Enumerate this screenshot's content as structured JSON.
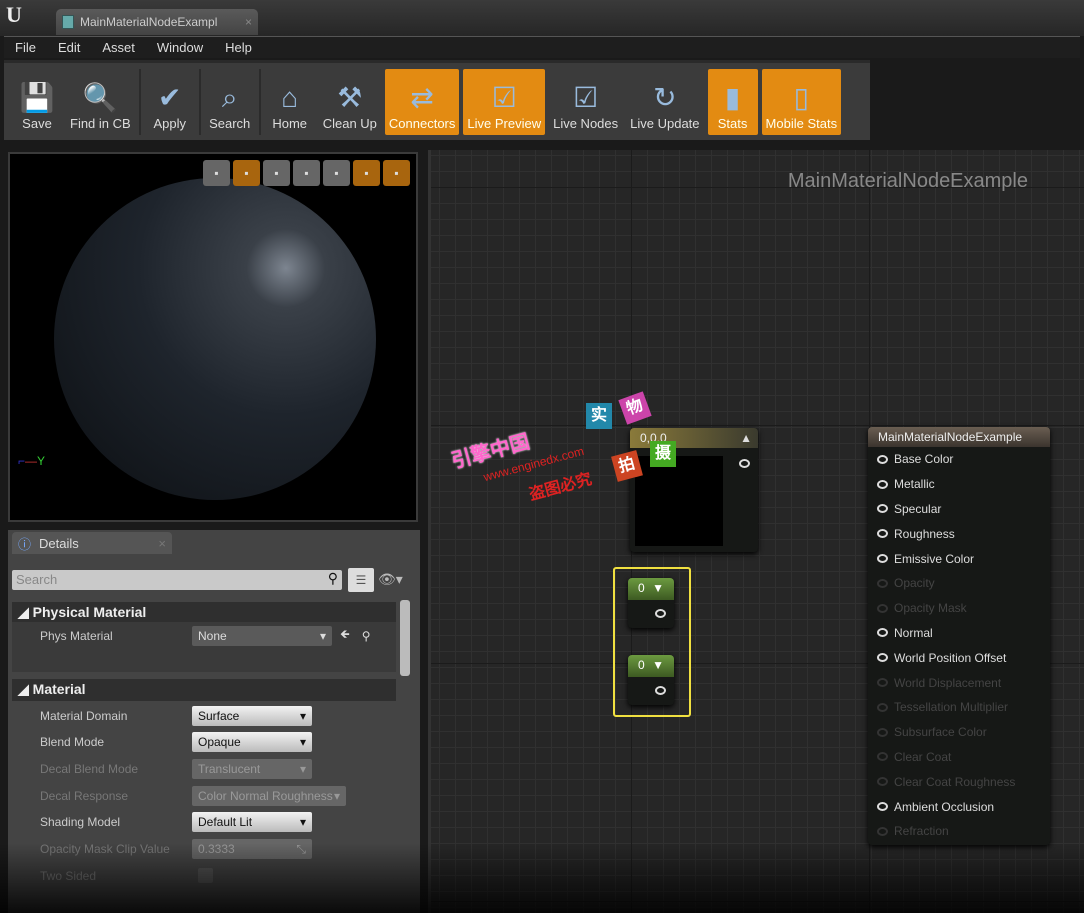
{
  "app": {
    "logo": "U",
    "tab_title": "MainMaterialNodeExampl",
    "tab_close": "×"
  },
  "menu": [
    "File",
    "Edit",
    "Asset",
    "Window",
    "Help"
  ],
  "toolbar": [
    {
      "label": "Save",
      "icon": "save-icon",
      "glyph": "💾",
      "active": false
    },
    {
      "label": "Find in CB",
      "icon": "magnifier-icon",
      "glyph": "🔍",
      "active": false
    },
    {
      "label": "Apply",
      "icon": "checkmark-icon",
      "glyph": "✔",
      "active": false
    },
    {
      "label": "Search",
      "icon": "binoculars-icon",
      "glyph": "⌕",
      "active": false
    },
    {
      "label": "Home",
      "icon": "home-icon",
      "glyph": "⌂",
      "active": false
    },
    {
      "label": "Clean Up",
      "icon": "broom-icon",
      "glyph": "⚒",
      "active": false
    },
    {
      "label": "Connectors",
      "icon": "connectors-icon",
      "glyph": "⇄",
      "active": true
    },
    {
      "label": "Live Preview",
      "icon": "tv-check-icon",
      "glyph": "☑",
      "active": true
    },
    {
      "label": "Live Nodes",
      "icon": "live-nodes-icon",
      "glyph": "☑",
      "active": false
    },
    {
      "label": "Live Update",
      "icon": "live-update-icon",
      "glyph": "↻",
      "active": false
    },
    {
      "label": "Stats",
      "icon": "bar-chart-icon",
      "glyph": "▮",
      "active": true
    },
    {
      "label": "Mobile Stats",
      "icon": "mobile-stats-icon",
      "glyph": "▯",
      "active": true
    }
  ],
  "viewport": {
    "axis_label": "Y",
    "tools": [
      {
        "icon": "cylinder-icon",
        "active": false
      },
      {
        "icon": "sphere-icon",
        "active": true
      },
      {
        "icon": "plane-icon",
        "active": false
      },
      {
        "icon": "cube-icon",
        "active": false
      },
      {
        "icon": "mesh-icon",
        "active": false
      },
      {
        "icon": "grid-icon",
        "active": true
      },
      {
        "icon": "realtime-icon",
        "active": true
      }
    ]
  },
  "details": {
    "tab": "Details",
    "close": "×",
    "search_placeholder": "Search",
    "categories": {
      "physical": "Physical Material",
      "material": "Material"
    },
    "phys_material": {
      "label": "Phys Material",
      "value": "None"
    },
    "rows": [
      {
        "label": "Material Domain",
        "value": "Surface",
        "enabled": true
      },
      {
        "label": "Blend Mode",
        "value": "Opaque",
        "enabled": true
      },
      {
        "label": "Decal Blend Mode",
        "value": "Translucent",
        "enabled": false
      },
      {
        "label": "Decal Response",
        "value": "Color Normal Roughness",
        "enabled": false
      },
      {
        "label": "Shading Model",
        "value": "Default Lit",
        "enabled": true
      },
      {
        "label": "Opacity Mask Clip Value",
        "value": "0.3333",
        "enabled": false
      },
      {
        "label": "Two Sided",
        "value": "",
        "enabled": false
      }
    ]
  },
  "graph": {
    "title": "MainMaterialNodeExample",
    "color_node": {
      "value": "0,0,0"
    },
    "constant_nodes": [
      {
        "value": "0"
      },
      {
        "value": "0"
      }
    ],
    "selection_color": "#f0e040",
    "material_node": {
      "title": "MainMaterialNodeExample",
      "inputs": [
        {
          "label": "Base Color",
          "enabled": true
        },
        {
          "label": "Metallic",
          "enabled": true
        },
        {
          "label": "Specular",
          "enabled": true
        },
        {
          "label": "Roughness",
          "enabled": true
        },
        {
          "label": "Emissive Color",
          "enabled": true
        },
        {
          "label": "Opacity",
          "enabled": false
        },
        {
          "label": "Opacity Mask",
          "enabled": false
        },
        {
          "label": "Normal",
          "enabled": true
        },
        {
          "label": "World Position Offset",
          "enabled": true
        },
        {
          "label": "World Displacement",
          "enabled": false
        },
        {
          "label": "Tessellation Multiplier",
          "enabled": false
        },
        {
          "label": "Subsurface Color",
          "enabled": false
        },
        {
          "label": "Clear Coat",
          "enabled": false
        },
        {
          "label": "Clear Coat Roughness",
          "enabled": false
        },
        {
          "label": "Ambient Occlusion",
          "enabled": true
        },
        {
          "label": "Refraction",
          "enabled": false
        }
      ]
    }
  },
  "watermark": {
    "site_name": "引擎中国",
    "url": "www.enginedx.com",
    "notice": "盗图必究",
    "badges": [
      "实",
      "物",
      "拍",
      "摄"
    ]
  }
}
